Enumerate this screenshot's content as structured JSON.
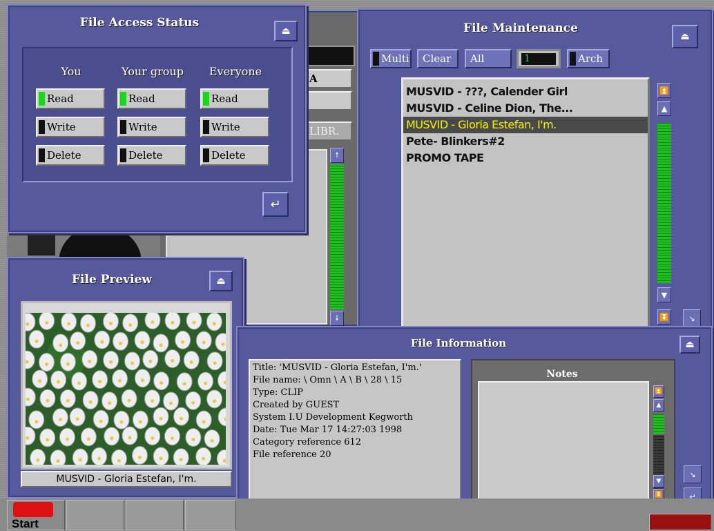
{
  "taskbar": {
    "start_label": "Start"
  },
  "background_window": {
    "field_a": "A",
    "field_libr": "LIBR."
  },
  "file_access": {
    "title": "File Access Status",
    "columns": [
      {
        "header": "You",
        "read": "Read",
        "write": "Write",
        "delete": "Delete",
        "read_on": true,
        "write_on": false,
        "delete_on": false
      },
      {
        "header": "Your group",
        "read": "Read",
        "write": "Write",
        "delete": "Delete",
        "read_on": true,
        "write_on": false,
        "delete_on": false
      },
      {
        "header": "Everyone",
        "read": "Read",
        "write": "Write",
        "delete": "Delete",
        "read_on": true,
        "write_on": false,
        "delete_on": false
      }
    ]
  },
  "file_maintenance": {
    "title": "File Maintenance",
    "toolbar": {
      "multi": "Multi",
      "clear": "Clear",
      "all": "All",
      "counter": "1",
      "arch": "Arch"
    },
    "items": [
      {
        "label": "MUSVID - ???, Calender Girl",
        "selected": false
      },
      {
        "label": "MUSVID - Celine Dion, The...",
        "selected": false
      },
      {
        "label": "MUSVID - Gloria Estefan, I'm.",
        "selected": true
      },
      {
        "label": "Pete- Blinkers#2",
        "selected": false
      },
      {
        "label": "PROMO TAPE",
        "selected": false
      }
    ]
  },
  "file_preview": {
    "title": "File Preview",
    "caption": "MUSVID - Gloria Estefan, I'm."
  },
  "file_info": {
    "title": "File Information",
    "lines": {
      "title": "Title:  'MUSVID - Gloria Estefan, I'm.'",
      "file_name": "File name: \\ Omn \\ A \\ B \\ 28 \\ 15",
      "type": "Type: CLIP",
      "created_by": "Created by GUEST",
      "system": "System I.U Development Kegworth",
      "date": "Date: Tue Mar 17 14:27:03 1998",
      "category": "Category reference 612",
      "file_ref": "File reference 20"
    },
    "notes_label": "Notes",
    "notes_text": ""
  },
  "colors": {
    "panel": "#565a9c",
    "list_bg": "#c3c3c3",
    "led_on": "#1ed41e",
    "selection_text": "#f5f200"
  }
}
